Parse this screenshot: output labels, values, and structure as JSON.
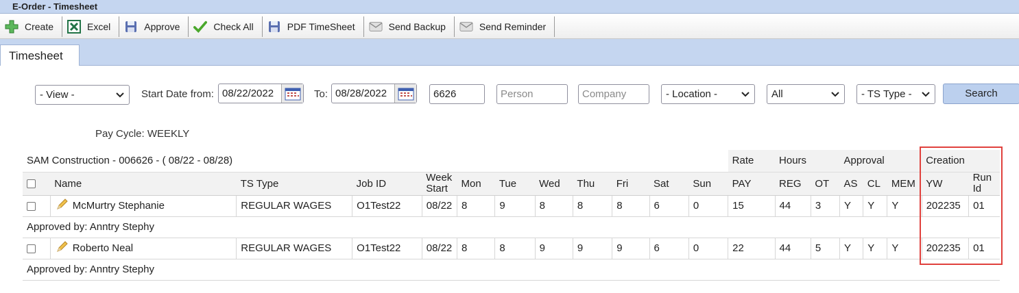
{
  "window": {
    "title": "E-Order - Timesheet"
  },
  "toolbar": {
    "buttons": [
      {
        "label": "Create",
        "icon": "plus-icon"
      },
      {
        "label": "Excel",
        "icon": "excel-icon"
      },
      {
        "label": "Approve",
        "icon": "floppy-icon"
      },
      {
        "label": "Check All",
        "icon": "checkmark-icon"
      },
      {
        "label": "PDF TimeSheet",
        "icon": "floppy-icon"
      },
      {
        "label": "Send Backup",
        "icon": "envelope-icon"
      },
      {
        "label": "Send Reminder",
        "icon": "envelope-icon"
      }
    ]
  },
  "tabs": [
    {
      "label": "Timesheet"
    }
  ],
  "filters": {
    "view": "- View -",
    "start_label": "Start Date from:",
    "start_date": "08/22/2022",
    "to_label": "To:",
    "end_date": "08/28/2022",
    "company_id": "6626",
    "person_placeholder": "Person",
    "company_placeholder": "Company",
    "location": "- Location -",
    "status": "All",
    "ts_type": "- TS Type -",
    "search_label": "Search"
  },
  "pay_cycle": "Pay Cycle: WEEKLY",
  "grid": {
    "group_title": "SAM Construction - 006626 - ( 08/22 - 08/28)",
    "groups": {
      "rate": "Rate",
      "hours": "Hours",
      "approval": "Approval",
      "creation": "Creation"
    },
    "columns": {
      "name": "Name",
      "ts_type": "TS Type",
      "job_id": "Job ID",
      "week_start_1": "Week",
      "week_start_2": "Start",
      "mon": "Mon",
      "tue": "Tue",
      "wed": "Wed",
      "thu": "Thu",
      "fri": "Fri",
      "sat": "Sat",
      "sun": "Sun",
      "pay": "PAY",
      "reg": "REG",
      "ot": "OT",
      "as": "AS",
      "cl": "CL",
      "mem": "MEM",
      "yw": "YW",
      "run_1": "Run",
      "run_2": "Id"
    },
    "rows": [
      {
        "name": "McMurtry Stephanie",
        "ts_type": "REGULAR WAGES",
        "job_id": "O1Test22",
        "week_start": "08/22",
        "mon": "8",
        "tue": "9",
        "wed": "8",
        "thu": "8",
        "fri": "8",
        "sat": "6",
        "sun": "0",
        "pay": "15",
        "reg": "44",
        "ot": "3",
        "as": "Y",
        "cl": "Y",
        "mem": "Y",
        "yw": "202235",
        "run_id": "01",
        "approved_by": "Approved by: Anntry Stephy"
      },
      {
        "name": "Roberto Neal",
        "ts_type": "REGULAR WAGES",
        "job_id": "O1Test22",
        "week_start": "08/22",
        "mon": "8",
        "tue": "8",
        "wed": "9",
        "thu": "9",
        "fri": "9",
        "sat": "6",
        "sun": "0",
        "pay": "22",
        "reg": "44",
        "ot": "5",
        "as": "Y",
        "cl": "Y",
        "mem": "Y",
        "yw": "202235",
        "run_id": "01",
        "approved_by": "Approved by: Anntry Stephy"
      }
    ]
  },
  "colors": {
    "header_blue": "#c5d6f0",
    "highlight": "#e0403c",
    "search_btn": "#bcd0ee"
  }
}
